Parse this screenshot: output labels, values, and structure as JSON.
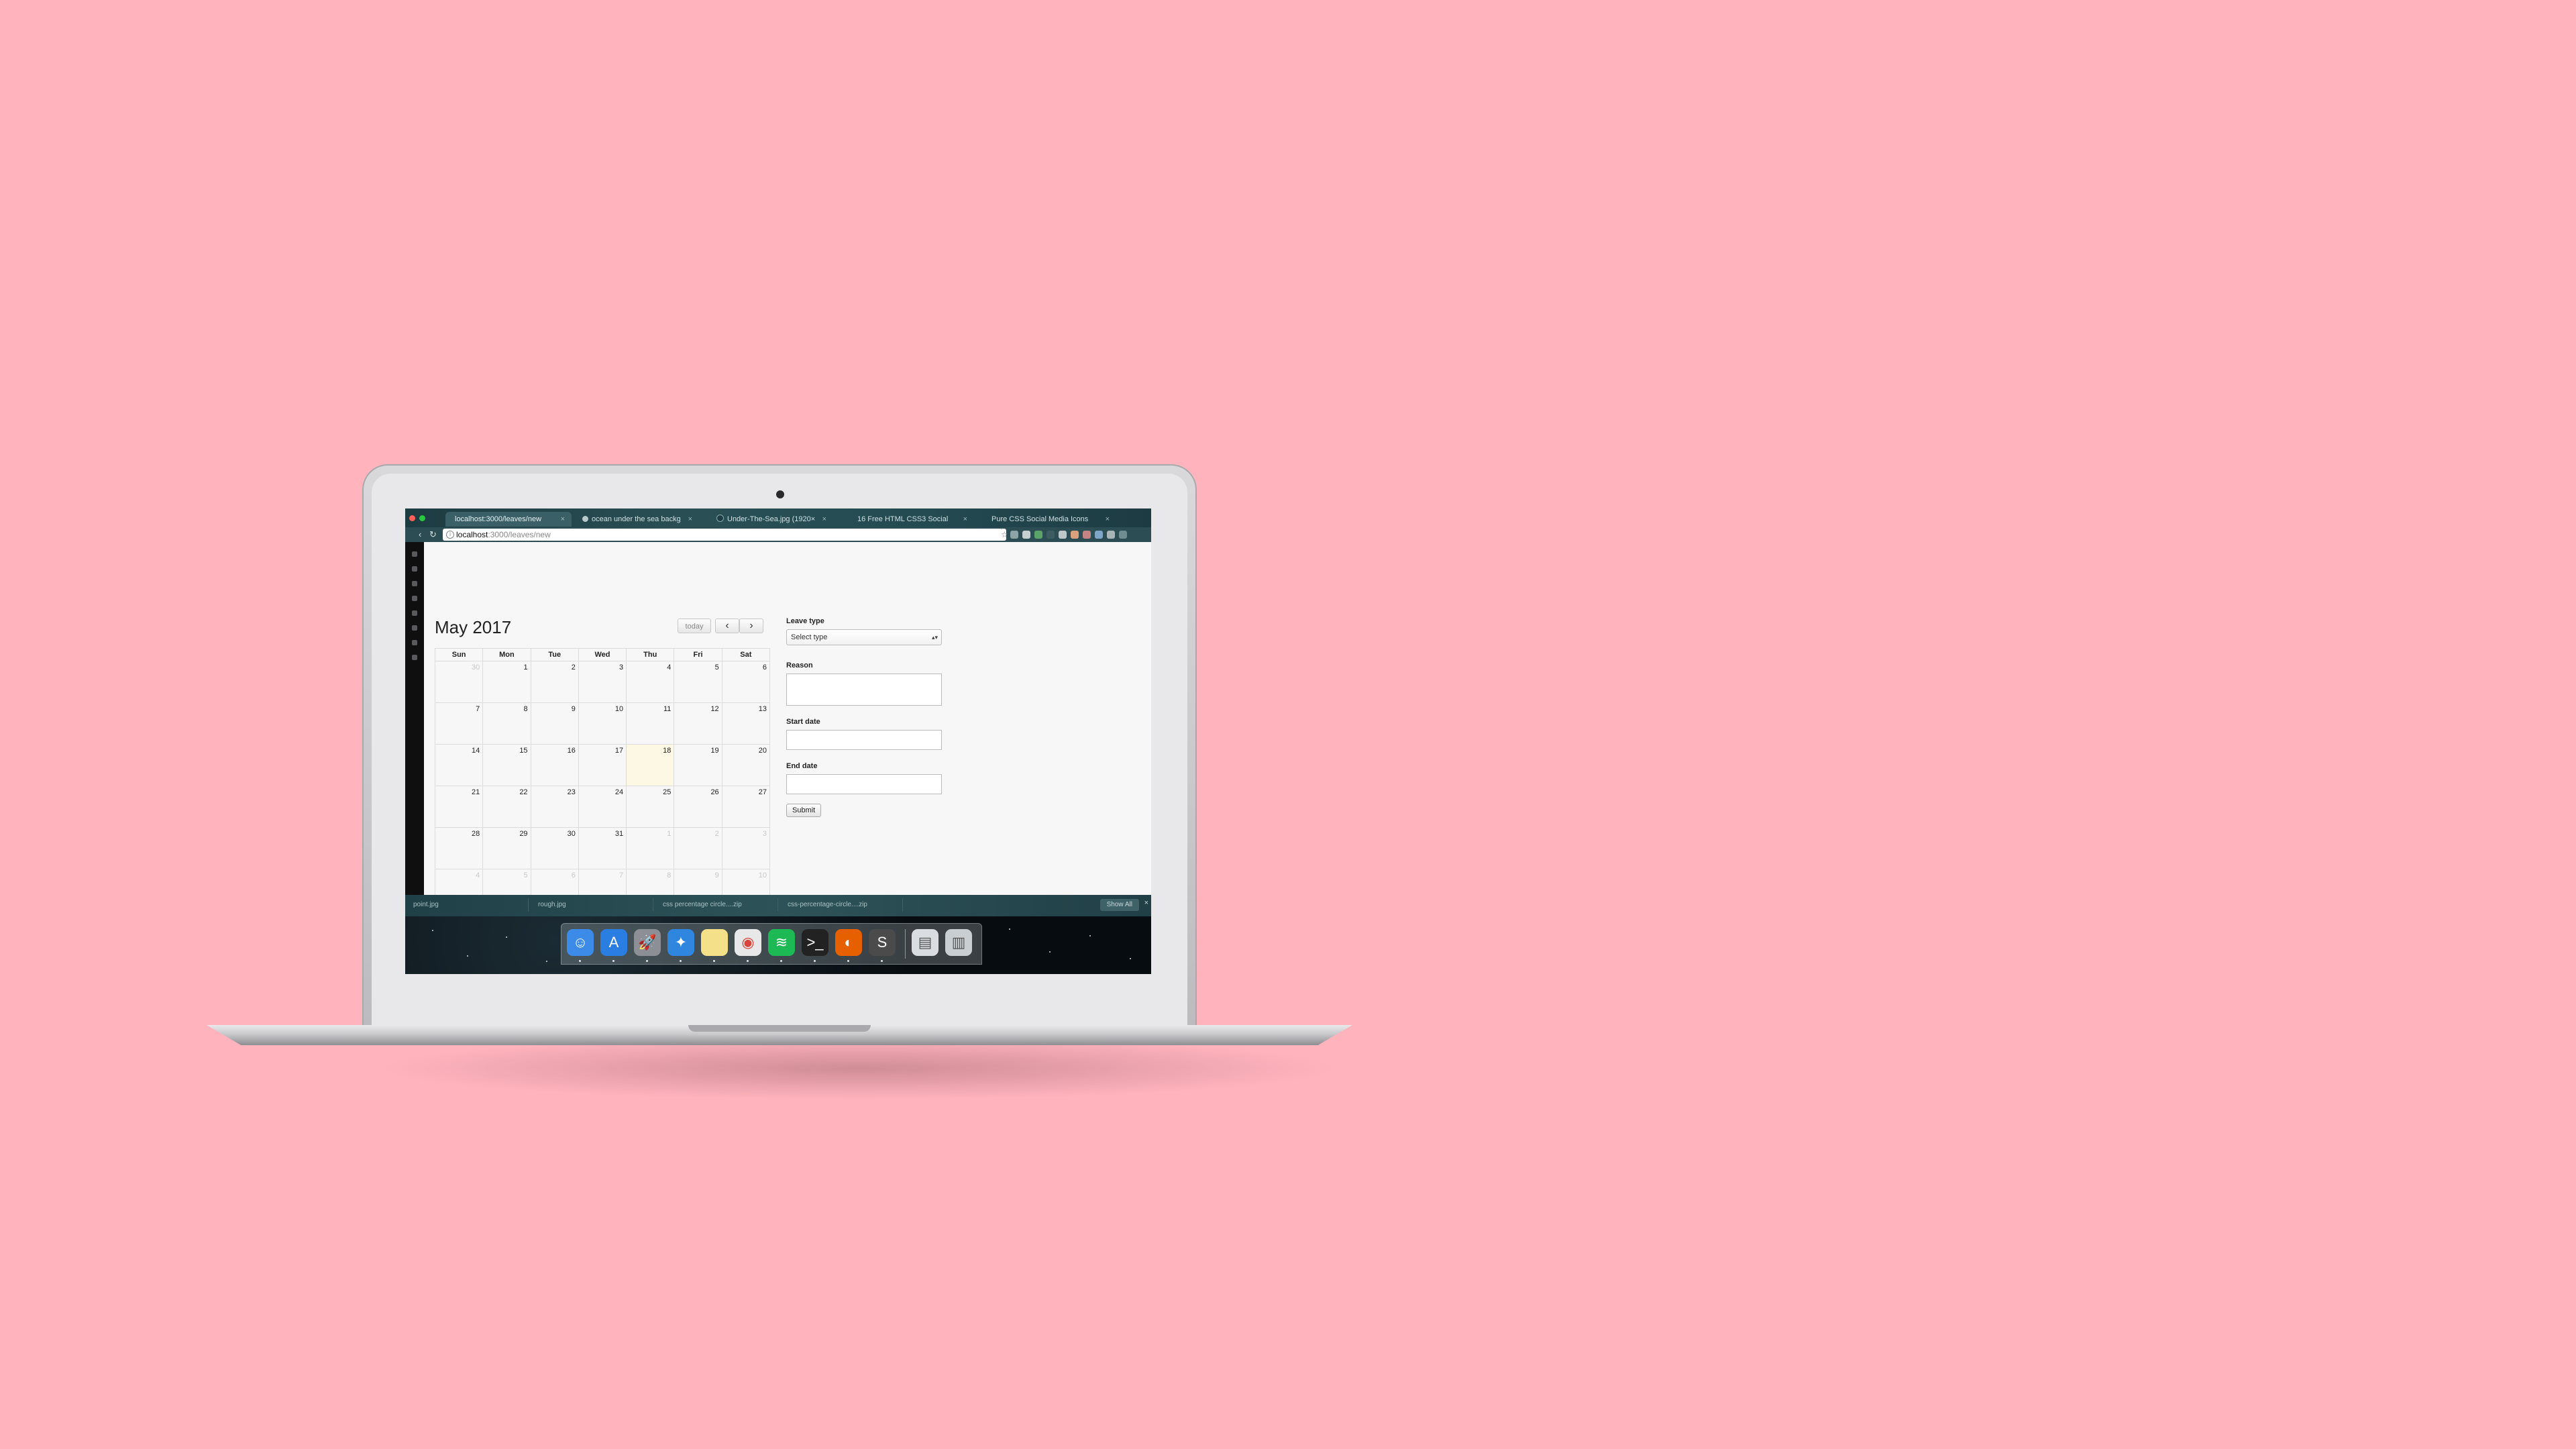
{
  "browser": {
    "tabs": [
      {
        "title": "localhost:3000/leaves/new",
        "active": true
      },
      {
        "title": "ocean under the sea backg",
        "active": false
      },
      {
        "title": "Under-The-Sea.jpg (1920×",
        "active": false
      },
      {
        "title": "16 Free HTML CSS3 Social",
        "active": false
      },
      {
        "title": "Pure CSS Social Media Icons",
        "active": false
      }
    ],
    "url_host": "localhost",
    "url_path": ":3000/leaves/new"
  },
  "calendar": {
    "title": "May 2017",
    "today_label": "today",
    "prev_icon": "‹",
    "next_icon": "›",
    "weekdays": [
      "Sun",
      "Mon",
      "Tue",
      "Wed",
      "Thu",
      "Fri",
      "Sat"
    ],
    "weeks": [
      [
        {
          "d": "30",
          "other": true
        },
        {
          "d": "1"
        },
        {
          "d": "2"
        },
        {
          "d": "3"
        },
        {
          "d": "4"
        },
        {
          "d": "5"
        },
        {
          "d": "6"
        }
      ],
      [
        {
          "d": "7"
        },
        {
          "d": "8"
        },
        {
          "d": "9"
        },
        {
          "d": "10"
        },
        {
          "d": "11"
        },
        {
          "d": "12"
        },
        {
          "d": "13"
        }
      ],
      [
        {
          "d": "14"
        },
        {
          "d": "15"
        },
        {
          "d": "16"
        },
        {
          "d": "17"
        },
        {
          "d": "18",
          "today": true
        },
        {
          "d": "19"
        },
        {
          "d": "20"
        }
      ],
      [
        {
          "d": "21"
        },
        {
          "d": "22"
        },
        {
          "d": "23"
        },
        {
          "d": "24"
        },
        {
          "d": "25"
        },
        {
          "d": "26"
        },
        {
          "d": "27"
        }
      ],
      [
        {
          "d": "28"
        },
        {
          "d": "29"
        },
        {
          "d": "30"
        },
        {
          "d": "31"
        },
        {
          "d": "1",
          "other": true
        },
        {
          "d": "2",
          "other": true
        },
        {
          "d": "3",
          "other": true
        }
      ],
      [
        {
          "d": "4",
          "other": true
        },
        {
          "d": "5",
          "other": true
        },
        {
          "d": "6",
          "other": true
        },
        {
          "d": "7",
          "other": true
        },
        {
          "d": "8",
          "other": true
        },
        {
          "d": "9",
          "other": true
        },
        {
          "d": "10",
          "other": true
        }
      ]
    ]
  },
  "form": {
    "leave_type_label": "Leave type",
    "leave_type_value": "Select type",
    "reason_label": "Reason",
    "start_date_label": "Start date",
    "end_date_label": "End date",
    "submit_label": "Submit"
  },
  "downloads": {
    "items": [
      "point.jpg",
      "rough.jpg",
      "css percentage circle....zip",
      "css-percentage-circle....zip"
    ],
    "show_all": "Show All"
  },
  "dock": {
    "apps": [
      {
        "name": "finder-icon",
        "color": "#3d8be8"
      },
      {
        "name": "app-store-icon",
        "color": "#2a7de1"
      },
      {
        "name": "launchpad-icon",
        "color": "#8c8f96"
      },
      {
        "name": "safari-icon",
        "color": "#2e86de"
      },
      {
        "name": "notes-icon",
        "color": "#f5e08a"
      },
      {
        "name": "chrome-icon",
        "color": "#e8e8e8"
      },
      {
        "name": "spotify-icon",
        "color": "#1db954"
      },
      {
        "name": "terminal-icon",
        "color": "#222222"
      },
      {
        "name": "firefox-icon",
        "color": "#e66000"
      },
      {
        "name": "sublime-text-icon",
        "color": "#4b4b4b"
      },
      {
        "name": "preview-icon",
        "color": "#d9dde2"
      },
      {
        "name": "trash-icon",
        "color": "#c9ced3"
      }
    ]
  },
  "colors": {
    "background": "#ffb3bd",
    "today_highlight": "#fcf8e3"
  }
}
